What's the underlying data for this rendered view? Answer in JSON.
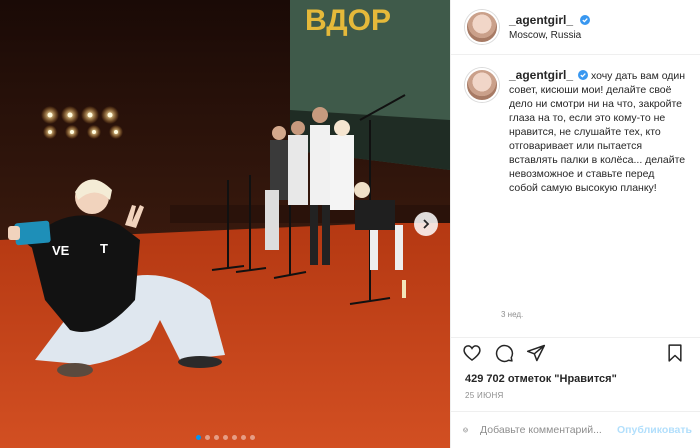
{
  "post": {
    "username": "_agentgirl_",
    "location": "Moscow, Russia",
    "caption": "хочу дать вам один совет, кисюши мои! делайте своё дело ни смотри ни на что, закройте глаза на то, если это кому-то не нравится, не слушайте тех, кто отговаривает или пытается вставлять палки в колёса... делайте невозможное и ставьте перед собой самую высокую планку!",
    "time_ago": "3 нед.",
    "likes_count": "429 702",
    "likes_label": "отметок \"Нравится\"",
    "date": "25 ИЮНЯ",
    "photo_count": 7,
    "active_photo": 0
  },
  "comment": {
    "placeholder": "Добавьте комментарий...",
    "post_label": "Опубликовать"
  },
  "icons": {
    "like": "heart-icon",
    "comment": "comment-icon",
    "share": "share-icon",
    "save": "bookmark-icon",
    "emoji": "emoji-icon",
    "verified": "verified-badge-icon",
    "next": "chevron-right-icon"
  },
  "colors": {
    "accent": "#0095f6",
    "verified": "#3897f0",
    "post_disabled": "#b2dffc",
    "floor": "#c2421a"
  },
  "screen_text": "ВДОР"
}
